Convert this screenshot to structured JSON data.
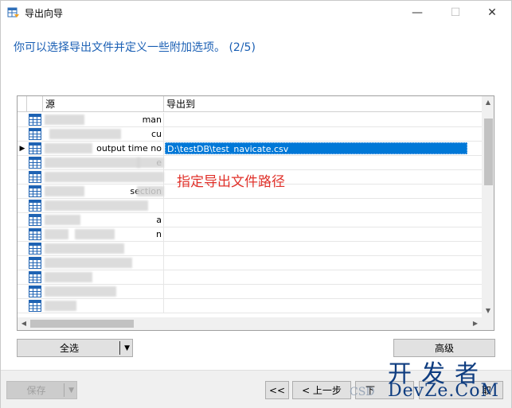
{
  "window": {
    "title": "导出向导",
    "minimize_glyph": "—",
    "maximize_glyph": "☐",
    "close_glyph": "✕"
  },
  "subtitle": "你可以选择导出文件并定义一些附加选项。 (2/5)",
  "grid": {
    "columns": {
      "source": "源",
      "export_to": "导出到"
    },
    "rows": [
      {
        "source": "man",
        "dest": "",
        "selected": false
      },
      {
        "source": "cu",
        "dest": "",
        "selected": false
      },
      {
        "source": "output time no",
        "dest": "D:\\testDB\\test_navicate.csv",
        "selected": true
      },
      {
        "source": "e",
        "dest": "",
        "selected": false
      },
      {
        "source": "",
        "dest": "",
        "selected": false
      },
      {
        "source": "section",
        "dest": "",
        "selected": false
      },
      {
        "source": "",
        "dest": "",
        "selected": false
      },
      {
        "source": "a",
        "dest": "",
        "selected": false
      },
      {
        "source": "n",
        "dest": "",
        "selected": false
      },
      {
        "source": "",
        "dest": "",
        "selected": false
      },
      {
        "source": "",
        "dest": "",
        "selected": false
      },
      {
        "source": "",
        "dest": "",
        "selected": false
      },
      {
        "source": "",
        "dest": "",
        "selected": false
      },
      {
        "source": "",
        "dest": "",
        "selected": false
      }
    ],
    "row_indicator": "▶"
  },
  "annotation": "指定导出文件路径",
  "buttons": {
    "select_all": "全选",
    "advanced": "高级",
    "save": "保存",
    "first": "<<",
    "prev": "< 上一步",
    "next": "下",
    "cancel": "取"
  },
  "watermark": {
    "top": "开发者",
    "bottom": "DevZe.CoM",
    "csdn": "CSD"
  },
  "colors": {
    "accent": "#1a5fb4",
    "selection": "#0078d7",
    "annotation": "#e0312a"
  }
}
